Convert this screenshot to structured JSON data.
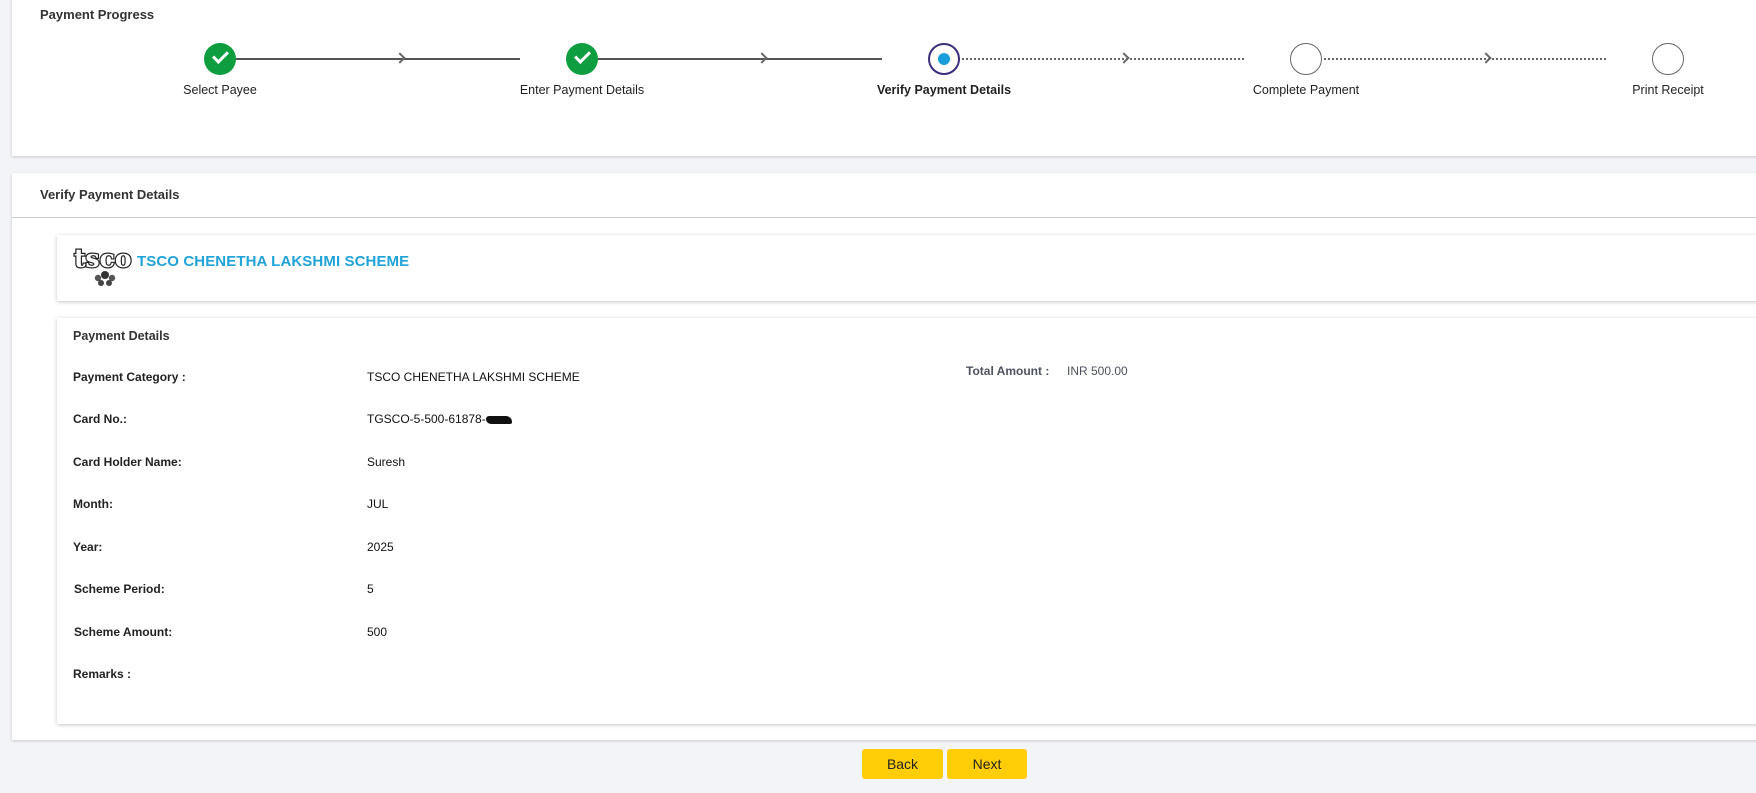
{
  "progress": {
    "title": "Payment Progress",
    "steps": [
      {
        "label": "Select Payee",
        "state": "done"
      },
      {
        "label": "Enter Payment Details",
        "state": "done"
      },
      {
        "label": "Verify Payment Details",
        "state": "active"
      },
      {
        "label": "Complete Payment",
        "state": "todo"
      },
      {
        "label": "Print Receipt",
        "state": "todo"
      }
    ]
  },
  "verify": {
    "title": "Verify Payment Details",
    "scheme_name": "TSCO CHENETHA LAKSHMI SCHEME",
    "logo_text": "tsco"
  },
  "details": {
    "title": "Payment Details",
    "fields": [
      {
        "label": "Payment Category :",
        "value": "TSCO CHENETHA LAKSHMI SCHEME"
      },
      {
        "label": "Card No.:",
        "value": "TGSCO-5-500-61878-"
      },
      {
        "label": "Card Holder Name:",
        "value": "Suresh"
      },
      {
        "label": "Month:",
        "value": "JUL"
      },
      {
        "label": "Year:",
        "value": "2025"
      },
      {
        "label": "Scheme Period:",
        "value": "5"
      },
      {
        "label": "Scheme Amount:",
        "value": "500"
      },
      {
        "label": "Remarks :",
        "value": ""
      }
    ],
    "total_label": "Total Amount :",
    "total_value": "INR 500.00"
  },
  "buttons": {
    "back": "Back",
    "next": "Next"
  },
  "colors": {
    "done": "#0e9d3f",
    "active_ring": "#3c2d7a",
    "active_dot": "#1a9ddb",
    "scheme_title": "#1fa3d8",
    "button": "#ffce06"
  }
}
